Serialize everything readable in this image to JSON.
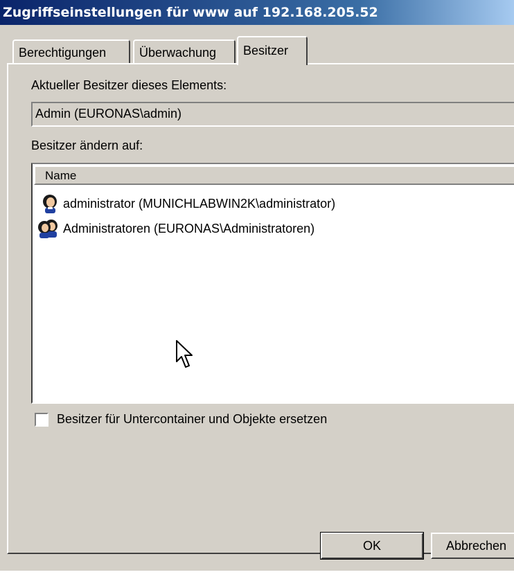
{
  "window": {
    "title": "Zugriffseinstellungen für www auf 192.168.205.52"
  },
  "tabs": [
    {
      "label": "Berechtigungen",
      "active": false
    },
    {
      "label": "Überwachung",
      "active": false
    },
    {
      "label": "Besitzer",
      "active": true
    }
  ],
  "owner": {
    "current_label": "Aktueller Besitzer dieses Elements:",
    "current_value": "Admin (EURONAS\\admin)",
    "change_label": "Besitzer ändern auf:"
  },
  "list": {
    "column_header": "Name",
    "items": [
      {
        "label": "administrator (MUNICHLABWIN2K\\administrator)",
        "icon": "user-icon"
      },
      {
        "label": "Administratoren (EURONAS\\Administratoren)",
        "icon": "group-icon"
      }
    ]
  },
  "replace_checkbox": {
    "label": "Besitzer für Untercontainer und Objekte ersetzen",
    "checked": false
  },
  "buttons": {
    "ok": "OK",
    "cancel": "Abbrechen"
  },
  "colors": {
    "titlebar": "#0a246a",
    "face": "#d4d0c8"
  }
}
